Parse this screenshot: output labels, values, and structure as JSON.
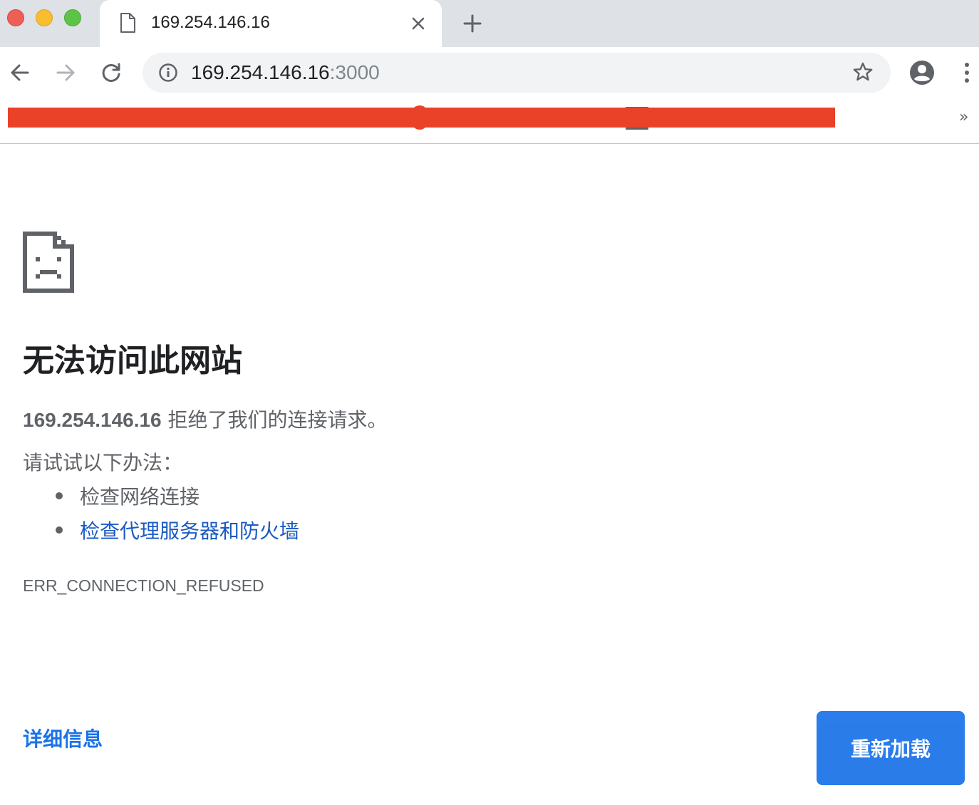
{
  "window": {
    "traffic_lights": [
      "close",
      "minimize",
      "zoom"
    ]
  },
  "tab": {
    "title": "169.254.146.16",
    "icon": "document-icon",
    "close_icon": "close-icon"
  },
  "new_tab_icon": "plus-icon",
  "toolbar": {
    "back_icon": "arrow-left-icon",
    "forward_icon": "arrow-right-icon",
    "reload_icon": "reload-icon",
    "address": {
      "host": "169.254.146.16",
      "port": ":3000",
      "security_icon": "info-icon",
      "bookmark_icon": "star-icon"
    },
    "profile_icon": "account-circle-icon",
    "menu_icon": "more-vertical-icon"
  },
  "bookmarks_bar": {
    "redacted": true,
    "overflow_label": "»"
  },
  "error": {
    "icon": "sad-document-icon",
    "heading": "无法访问此网站",
    "host": "169.254.146.16",
    "summary_rest": " 拒绝了我们的连接请求。",
    "suggest_label": "请试试以下办法：",
    "suggestions": [
      {
        "label": "检查网络连接",
        "is_link": false
      },
      {
        "label": "检查代理服务器和防火墙",
        "is_link": true
      }
    ],
    "code": "ERR_CONNECTION_REFUSED",
    "details_label": "详细信息",
    "reload_label": "重新加载"
  },
  "colors": {
    "tabstrip_bg": "#dee1e6",
    "omnibox_bg": "#f1f3f4",
    "redaction": "#ea4129",
    "primary_blue": "#1a73e8",
    "link_blue": "#1a5ac2",
    "text_secondary": "#5f6368",
    "text_primary": "#202124"
  }
}
